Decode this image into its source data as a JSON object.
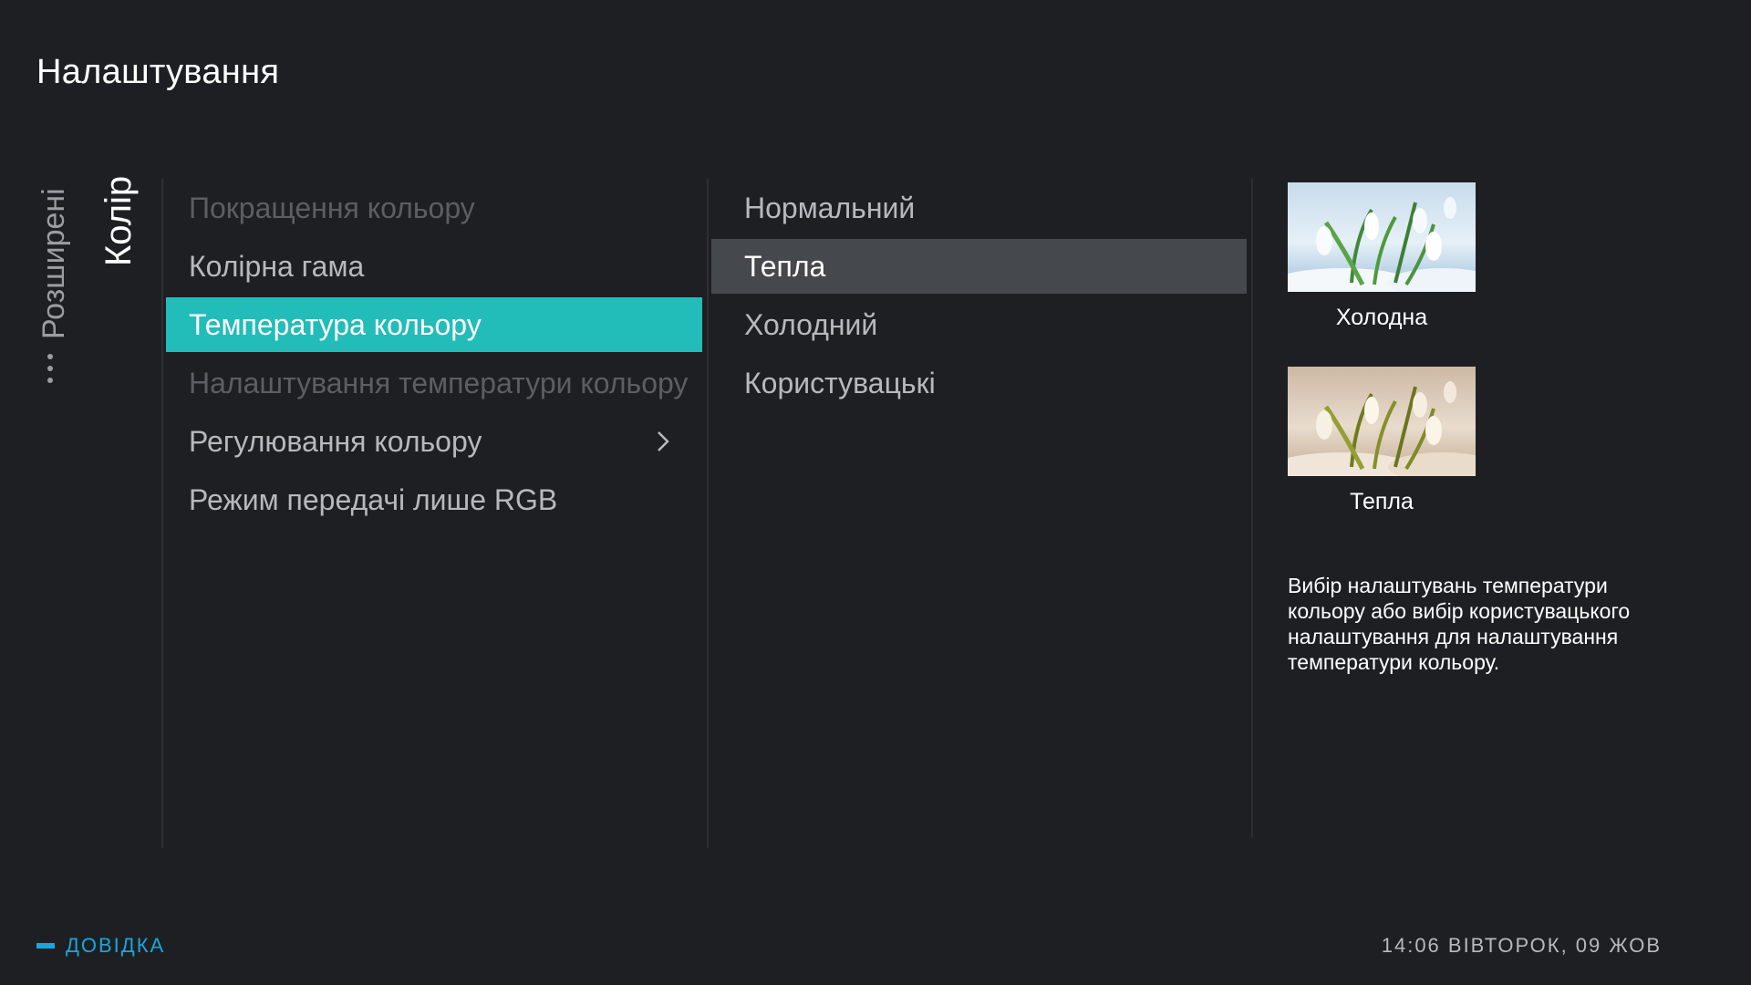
{
  "header": {
    "title": "Налаштування"
  },
  "breadcrumb": {
    "previous": "Розширені",
    "current": "Колір"
  },
  "menu": {
    "items": [
      {
        "label": "Покращення кольору",
        "state": "disabled"
      },
      {
        "label": "Колірна гама",
        "state": "normal"
      },
      {
        "label": "Температура кольору",
        "state": "selected"
      },
      {
        "label": "Налаштування температури кольору",
        "state": "disabled"
      },
      {
        "label": "Регулювання кольору",
        "state": "normal",
        "has_submenu": true
      },
      {
        "label": "Режим передачі лише RGB",
        "state": "normal"
      }
    ]
  },
  "options": {
    "items": [
      {
        "label": "Нормальний",
        "state": "normal"
      },
      {
        "label": "Тепла",
        "state": "active"
      },
      {
        "label": "Холодний",
        "state": "normal"
      },
      {
        "label": "Користувацькі",
        "state": "normal"
      }
    ]
  },
  "previews": [
    {
      "caption": "Холодна"
    },
    {
      "caption": "Тепла"
    }
  ],
  "description": "Вибір налаштувань температури кольору або вибір користувацького налаштування для налаштування температури кольору.",
  "footer": {
    "help_label": "ДОВІДКА",
    "clock": "14:06 ВІВТОРОК, 09 ЖОВ"
  },
  "colors": {
    "background": "#1d1f23",
    "selected": "#22bcb9",
    "active": "#45484d",
    "help_accent": "#1aa6dc"
  }
}
